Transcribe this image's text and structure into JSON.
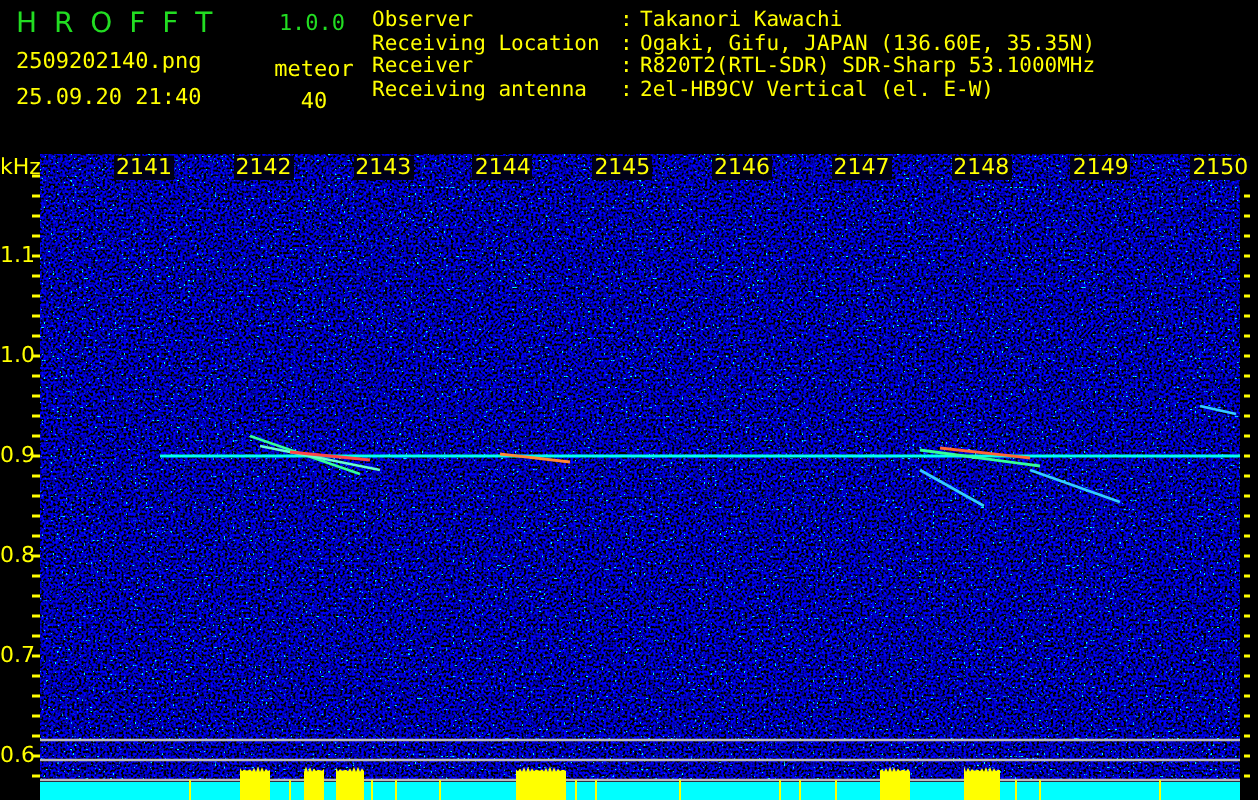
{
  "app": {
    "name": "H R O F F T",
    "version": "1.0.0"
  },
  "file": "2509202140.png",
  "datetime": "25.09.20 21:40",
  "detection": {
    "label": "meteor",
    "count": "40"
  },
  "info": [
    {
      "label": "Observer",
      "separator": ":",
      "value": "Takanori Kawachi"
    },
    {
      "label": "Receiving Location",
      "separator": ":",
      "value": "Ogaki, Gifu, JAPAN (136.60E, 35.35N)"
    },
    {
      "label": "Receiver",
      "separator": ":",
      "value": "R820T2(RTL-SDR) SDR-Sharp 53.1000MHz"
    },
    {
      "label": "Receiving antenna",
      "separator": ":",
      "value": "2el-HB9CV Vertical (el. E-W)"
    }
  ],
  "spectrogram": {
    "unit": "kHz",
    "time_labels": [
      "2141",
      "2142",
      "2143",
      "2144",
      "2145",
      "2146",
      "2147",
      "2148",
      "2149",
      "2150"
    ],
    "freq_labels": [
      "1.1",
      "1.0",
      "0.9",
      "0.8",
      "0.7",
      "0.6"
    ]
  }
}
